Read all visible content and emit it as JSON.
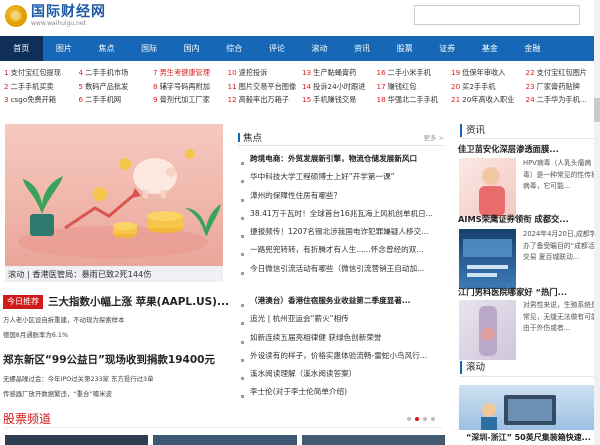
{
  "header": {
    "logo_cn": "国际财经网",
    "logo_en": "www.waihuigu.net",
    "search_placeholder": ""
  },
  "nav": [
    "首页",
    "图片",
    "焦点",
    "国际",
    "国内",
    "综合",
    "评论",
    "滚动",
    "资讯",
    "股票",
    "证券",
    "基金",
    "金融",
    "",
    ""
  ],
  "links": [
    [
      {
        "n": "1",
        "t": "支付宝红包提现"
      },
      {
        "n": "4",
        "t": "二手手机市场"
      },
      {
        "n": "7",
        "t": "男生考健康管理",
        "red": true
      },
      {
        "n": "10",
        "t": "速挖投诉"
      },
      {
        "n": "13",
        "t": "生产黏蝇膏药"
      },
      {
        "n": "16",
        "t": "二手小米手机"
      },
      {
        "n": "19",
        "t": "低保年审收入"
      },
      {
        "n": "22",
        "t": "支付宝红包图片"
      }
    ],
    [
      {
        "n": "2",
        "t": "二手手机买卖"
      },
      {
        "n": "5",
        "t": "数码产品批发"
      },
      {
        "n": "8",
        "t": "辅字号码再附加"
      },
      {
        "n": "11",
        "t": "图片交易平台图像"
      },
      {
        "n": "14",
        "t": "投诉24小时跟进"
      },
      {
        "n": "17",
        "t": "赚钱红包"
      },
      {
        "n": "20",
        "t": "买2手手机"
      },
      {
        "n": "23",
        "t": "厂家膏药贴牌"
      }
    ],
    [
      {
        "n": "3",
        "t": "csgo免费开箱"
      },
      {
        "n": "6",
        "t": "二手手机网"
      },
      {
        "n": "9",
        "t": "膏剂代加工厂家"
      },
      {
        "n": "12",
        "t": "高毅率出万箱子"
      },
      {
        "n": "15",
        "t": "手机赚钱交易"
      },
      {
        "n": "18",
        "t": "华强北二手手机"
      },
      {
        "n": "21",
        "t": "20年高收入职业"
      },
      {
        "n": "24",
        "t": "二手华为手机..."
      }
    ]
  ],
  "hero": {
    "caption": "滚动 | 香港医管局：暴雨已致2死144伤"
  },
  "focus": {
    "title": "焦点",
    "more": "更多 >",
    "items": [
      {
        "t": "跨境电商：外贸发展新引擎，物流仓储发展新风口",
        "lead": true
      },
      {
        "t": "华中科技大学工程硕博士上好“开学第一课”"
      },
      {
        "t": "漳州的保障性住房有哪些？"
      },
      {
        "t": "38.41万千瓦时！全球首台16兆瓦海上风机创单机日..."
      },
      {
        "t": "捷报频传！1207名锡北涉我国电诈犯罪嫌疑人移交..."
      },
      {
        "t": "一路兜兜转转，有折腾才有人生......怀念曾经的双..."
      },
      {
        "t": "今日微信引流活动有哪些（微信引流营销王自动加..."
      }
    ],
    "items2": [
      {
        "t": "（港澳台）香港住宿服务业收益第二季度显著...",
        "lead": true
      },
      {
        "t": "追光 | 杭州亚运会“薪火”相传"
      },
      {
        "t": "如新连续五届亮相律健 获绿色创新荣誉"
      },
      {
        "t": "外设读有的样子，价格实惠体验流畅-雷蛇小鸟风行..."
      },
      {
        "t": "溪水阅读理解（溪水阅读答案）"
      },
      {
        "t": "李士伦(对于李士伦简单介绍)"
      }
    ]
  },
  "headlines": {
    "tag": "今日推荐",
    "h1": "三大指数小幅上涨 苹果(AAPL.US)...",
    "h1_sub1": "万人老小区设自拆重建，不动现为探索样本",
    "h1_sub2": "德国8月通胀率为6.1%",
    "h2": "郑东新区“99公益日”现场收到捐款19400元",
    "h2_sub": "无螺晶噪过会：今年IPO过关第233家 东方投行过3单",
    "h2_sub2": "传感器厂放开数据繁违，“重合”噱米波"
  },
  "stocks_section": {
    "title": "股票频道"
  },
  "sidebar": {
    "news_head": "资讯",
    "news": [
      {
        "title": "佳卫苗安化深层渗透面膜...",
        "desc": "HPV病毒（人乳头瘤病毒）是一种常见的性传播病毒，它可能..."
      },
      {
        "title": "AIMS荣鹰证券领衔 成都交...",
        "desc": "2024年4月20日,成都学办了备受瞩目的“成都活交易 夏百城联动..."
      },
      {
        "title": "江门男科医院哪家好 “热门...",
        "desc": "对男性来说，生殖系统是常见，无缝无法做有可能由于外伤或者..."
      }
    ],
    "scroll_head": "滚动",
    "bottom_title": "“深圳-浙江” 50英尺集装箱快速..."
  }
}
